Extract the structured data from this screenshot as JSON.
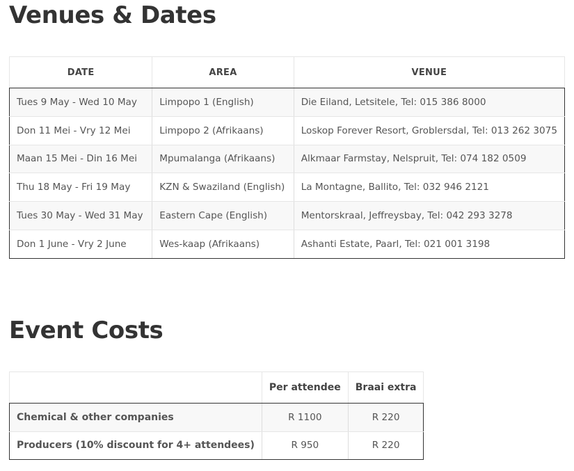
{
  "venues_section": {
    "heading": "Venues & Dates",
    "headers": {
      "date": "DATE",
      "area": "AREA",
      "venue": "VENUE"
    },
    "rows": [
      {
        "date": "Tues 9 May - Wed 10 May",
        "area": "Limpopo 1 (English)",
        "venue": "Die Eiland, Letsitele, Tel: 015 386 8000"
      },
      {
        "date": "Don 11 Mei - Vry 12 Mei",
        "area": "Limpopo 2 (Afrikaans)",
        "venue": "Loskop Forever Resort, Groblersdal, Tel: 013 262 3075"
      },
      {
        "date": "Maan 15 Mei - Din 16 Mei",
        "area": "Mpumalanga (Afrikaans)",
        "venue": "Alkmaar Farmstay, Nelspruit, Tel: 074 182 0509"
      },
      {
        "date": "Thu 18 May - Fri 19 May",
        "area": "KZN & Swaziland (English)",
        "venue": "La Montagne, Ballito, Tel: 032 946 2121"
      },
      {
        "date": "Tues 30 May - Wed 31 May",
        "area": "Eastern Cape (English)",
        "venue": "Mentorskraal, Jeffreysbay, Tel: 042 293 3278"
      },
      {
        "date": "Don 1 June - Vry 2 June",
        "area": "Wes-kaap (Afrikaans)",
        "venue": "Ashanti Estate, Paarl, Tel: 021 001 3198"
      }
    ]
  },
  "costs_section": {
    "heading": "Event Costs",
    "headers": {
      "item": "",
      "per_attendee": "Per attendee",
      "braai_extra": "Braai extra"
    },
    "rows": [
      {
        "item": "Chemical & other companies",
        "per_attendee": "R 1100",
        "braai_extra": "R 220"
      },
      {
        "item": "Producers (10% discount for 4+ attendees)",
        "per_attendee": "R 950",
        "braai_extra": "R 220"
      }
    ]
  }
}
